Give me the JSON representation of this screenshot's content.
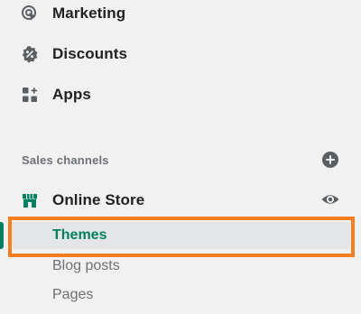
{
  "nav": {
    "items": [
      {
        "label": "Marketing",
        "icon": "target-icon"
      },
      {
        "label": "Discounts",
        "icon": "discount-icon"
      },
      {
        "label": "Apps",
        "icon": "apps-icon"
      }
    ]
  },
  "sales_channels": {
    "title": "Sales channels",
    "add_icon": "plus-circle-icon",
    "channel": {
      "label": "Online Store",
      "icon": "store-icon",
      "view_icon": "eye-icon"
    },
    "sub_items": [
      {
        "label": "Themes",
        "active": true
      },
      {
        "label": "Blog posts",
        "active": false
      },
      {
        "label": "Pages",
        "active": false
      }
    ]
  },
  "colors": {
    "accent": "#008060",
    "active_text": "#007f5f",
    "highlight": "#f57e20",
    "background": "#f1f1f1"
  }
}
